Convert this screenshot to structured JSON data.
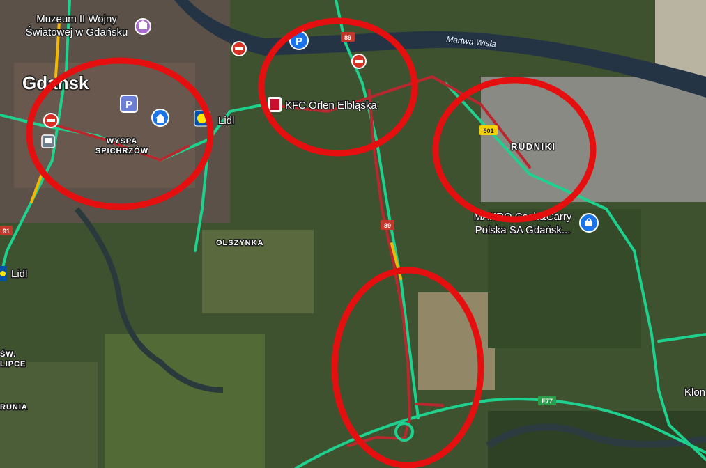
{
  "places": {
    "city": "Gdańsk",
    "museum": "Muzeum II Wojny\nŚwiatowej w Gdańsku",
    "wyspa": "WYSPA\nSPICHRZÓW",
    "lidl_center": "Lidl",
    "lidl_left": "Lidl",
    "kfc": "KFC Orlen Elbląska",
    "rudniki": "RUDNIKI",
    "makro": "MAKRO Cash&Carry\nPolska SA Gdańsk...",
    "olszynka": "OLSZYNKA",
    "sw_lipce": "ŚW.\nLIPCE",
    "rudnia": "RUNIA",
    "klon": "Klon",
    "river": "Martwa Wisła"
  },
  "road_shields": {
    "r89_top": "89",
    "r89_mid": "89",
    "r501": "501",
    "r91": "91",
    "e77": "E77"
  },
  "icons": [
    "museum-icon",
    "parking-icon",
    "home-icon",
    "lidl-icon",
    "no-entry-icon",
    "kfc-icon",
    "makro-icon"
  ],
  "colors": {
    "traffic_free": "#1fd18f",
    "traffic_heavy": "#b8282e",
    "traffic_moderate": "#f2b705",
    "annotation_circle": "#e60f0f"
  }
}
